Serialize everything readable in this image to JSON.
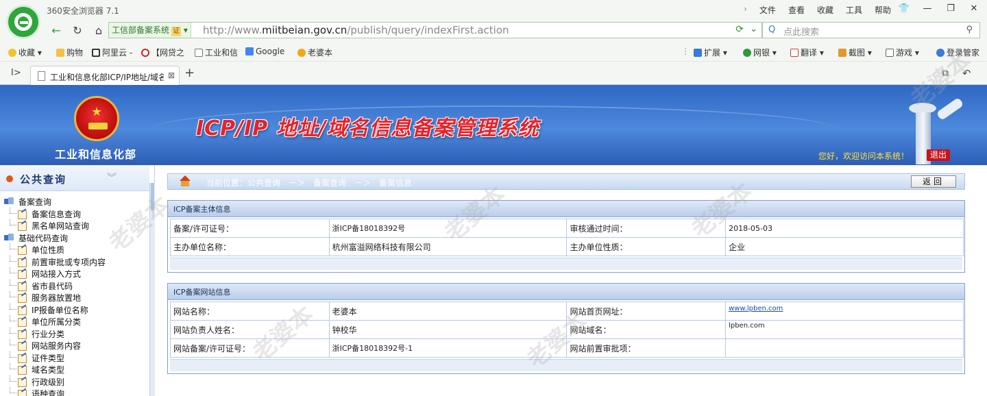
{
  "browser": {
    "title": "360安全浏览器 7.1",
    "menus": [
      "文件",
      "查看",
      "收藏",
      "工具",
      "帮助"
    ],
    "site_chip": "工信部备案系统",
    "site_chip_badge": "证",
    "url_prefix": "http://www.",
    "url_domain": "miitbeian.gov.cn",
    "url_path": "/publish/query/indexFirst.action",
    "search_placeholder": "点此搜索",
    "bookmarks": [
      "收藏",
      "购物",
      "阿里云 -",
      "【网贷之",
      "工业和信",
      "Google",
      "老婆本"
    ],
    "toolbar_right": [
      "扩展",
      "网银",
      "翻译",
      "截图",
      "游戏",
      "登录管家"
    ],
    "tab_title": "工业和信息化部ICP/IP地址/域名"
  },
  "header": {
    "ministry": "工业和信息化部",
    "system_title": "ICP/IP 地址/域名信息备案管理系统",
    "welcome": "您好，欢迎访问本系统！",
    "logout": "退出"
  },
  "sidebar": {
    "section": "公共查询",
    "groups": [
      {
        "label": "备案查询",
        "items": [
          "备案信息查询",
          "黑名单网站查询"
        ]
      },
      {
        "label": "基础代码查询",
        "items": [
          "单位性质",
          "前置审批或专项内容",
          "网站接入方式",
          "省市县代码",
          "服务器放置地",
          "IP报备单位名称",
          "单位所属分类",
          "行业分类",
          "网站服务内容",
          "证件类型",
          "域名类型",
          "行政级别",
          "语种查询"
        ]
      }
    ]
  },
  "main": {
    "breadcrumb": "当前位置：公共查询　－＞　备案查询　－＞　备案信息",
    "back_button": "返回",
    "entity_panel": {
      "title": "ICP备案主体信息",
      "rows": [
        {
          "k1": "备案/许可证号：",
          "v1": "浙ICP备18018392号",
          "k2": "审核通过时间：",
          "v2": "2018-05-03"
        },
        {
          "k1": "主办单位名称：",
          "v1": "杭州富溢网络科技有限公司",
          "k2": "主办单位性质：",
          "v2": "企业"
        }
      ]
    },
    "site_panel": {
      "title": "ICP备案网站信息",
      "rows": [
        {
          "k1": "网站名称：",
          "v1": "老婆本",
          "k2": "网站首页网址：",
          "v2": "www.lpben.com"
        },
        {
          "k1": "网站负责人姓名：",
          "v1": "钟校华",
          "k2": "网站域名：",
          "v2": "lpben.com"
        },
        {
          "k1": "网站备案/许可证号：",
          "v1": "浙ICP备18018392号-1",
          "k2": "网站前置审批项：",
          "v2": ""
        }
      ]
    }
  },
  "watermark": "老婆本"
}
